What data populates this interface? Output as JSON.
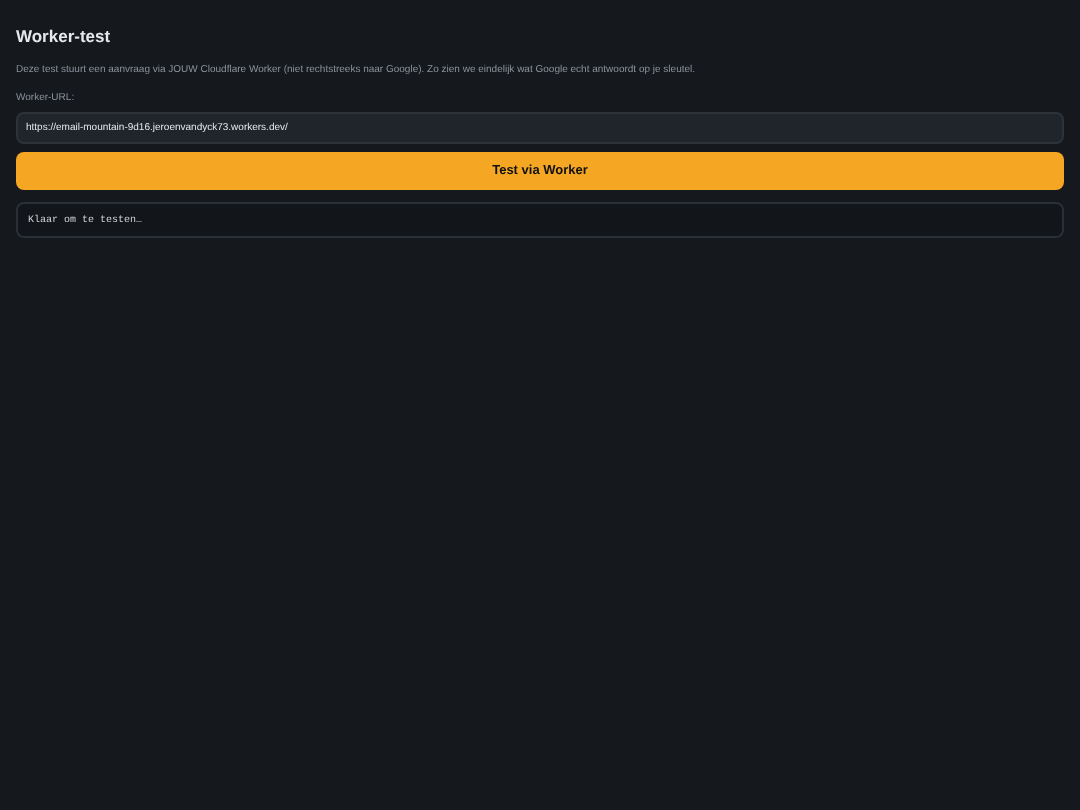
{
  "title": "Worker-test",
  "description": "Deze test stuurt een aanvraag via JOUW Cloudflare Worker (niet rechtstreeks naar Google). Zo zien we eindelijk wat Google echt antwoordt op je sleutel.",
  "url_field": {
    "label": "Worker-URL:",
    "value": "https://email-mountain-9d16.jeroenvandyck73.workers.dev/"
  },
  "button": "Test via Worker",
  "output": "Klaar om te testen…"
}
